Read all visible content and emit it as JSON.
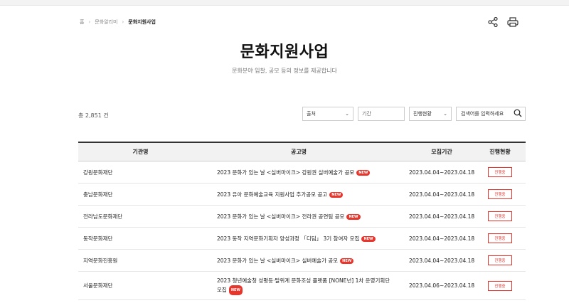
{
  "breadcrumb": {
    "home": "홈",
    "level1": "문화알리미",
    "current": "문화지원사업"
  },
  "page": {
    "title": "문화지원사업",
    "subtitle": "문화분야 입찰, 공모 등의 정보를 제공합니다"
  },
  "count": {
    "text": "총 2,851 건"
  },
  "filters": {
    "source": "출처",
    "period_placeholder": "기간",
    "status": "진행현황",
    "search_placeholder": "검색어를 입력하세요"
  },
  "table": {
    "headers": {
      "org": "기관명",
      "notice": "공고명",
      "period": "모집기간",
      "status": "진행현황"
    },
    "new_label": "NEW",
    "rows": [
      {
        "org": "강원문화재단",
        "notice": "2023 문화가 있는 날 <실버마이크> 강원권 실버예술가 공모",
        "period": "2023.04.04~2023.04.18",
        "status": "진행중"
      },
      {
        "org": "충남문화재단",
        "notice": "2023 유아 문화예술교육 지원사업 추가공모 공고",
        "period": "2023.04.04~2023.04.18",
        "status": "진행중"
      },
      {
        "org": "전라남도문화재단",
        "notice": "2023 문화가 있는 날 <실버마이크> 전라권 공연팀 공모",
        "period": "2023.04.04~2023.04.18",
        "status": "진행중"
      },
      {
        "org": "동작문화재단",
        "notice": "2023 동작 지역문화기획자 양성과정 「디딤」 3기 참여자 모집",
        "period": "2023.04.04~2023.04.18",
        "status": "진행중"
      },
      {
        "org": "지역문화진흥원",
        "notice": "2023 문화가 있는 날 <실버마이크> 실버예술가 공모",
        "period": "2023.04.04~2023.04.18",
        "status": "진행중"
      },
      {
        "org": "서울문화재단",
        "notice_line1": "2023 청년예술청 성평등·탈위계 문화조성 플랫폼 [NONE넌] 1차 운영기획단",
        "notice_line2": "모집",
        "period": "2023.04.06~2023.04.18",
        "status": "진행중"
      }
    ]
  }
}
